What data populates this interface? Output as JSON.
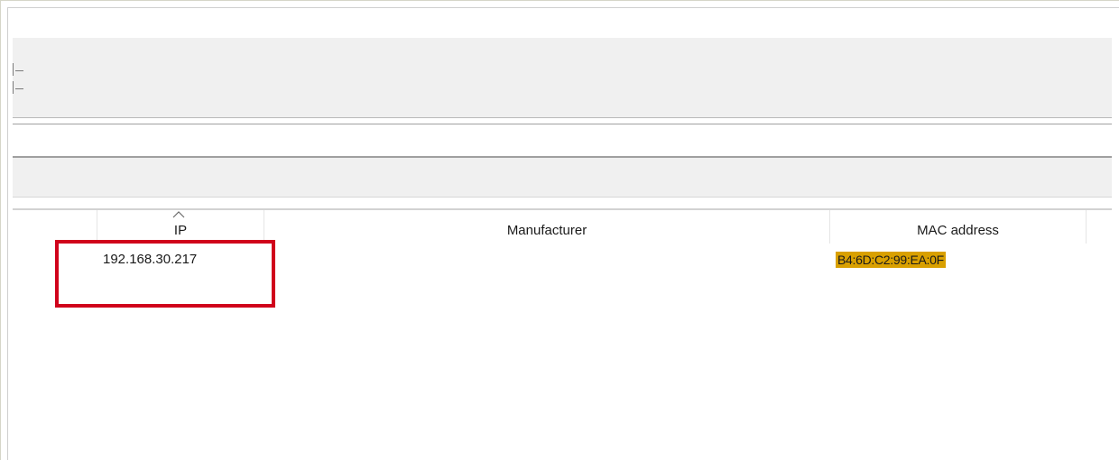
{
  "table": {
    "columns": [
      "",
      "IP",
      "Manufacturer",
      "MAC address",
      ""
    ],
    "sort_column": "IP",
    "rows": [
      {
        "ip": "192.168.30.217",
        "manufacturer": "",
        "mac": "B4:6D:C2:99:EA:0F"
      }
    ]
  },
  "colors": {
    "highlight_box": "#d0021b",
    "mac_highlight": "#d9a000",
    "toolbar_bg": "#f0f0f0"
  },
  "icons": {
    "sort": "sort-ascending-icon",
    "grip": "toolbar-grip-icon"
  }
}
